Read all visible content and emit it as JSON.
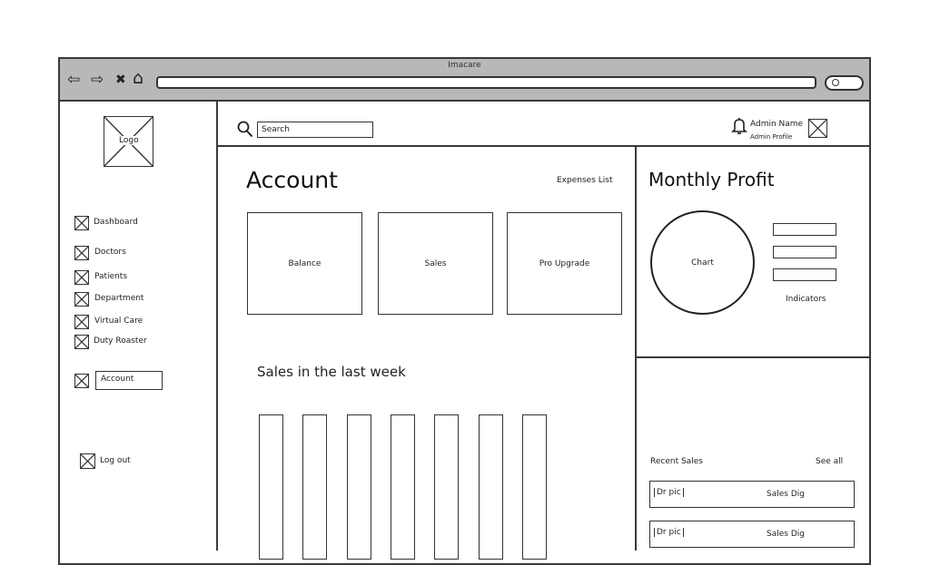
{
  "browser": {
    "title": "Imacare",
    "nav_back": "⇦",
    "nav_forward": "⇨",
    "nav_close": "✖",
    "nav_home": "⌂",
    "search_button": "🔍"
  },
  "sidebar": {
    "logo_label": "Logo",
    "items": [
      {
        "label": "Dashboard"
      },
      {
        "label": "Doctors"
      },
      {
        "label": "Patients"
      },
      {
        "label": "Department"
      },
      {
        "label": "Virtual Care"
      },
      {
        "label": "Duty Roaster"
      },
      {
        "label": "Account"
      }
    ],
    "logout_label": "Log out"
  },
  "header": {
    "search_placeholder": "Search",
    "admin_name": "Admin Name",
    "admin_profile": "Admin Profile"
  },
  "account": {
    "title": "Account",
    "expenses_link": "Expenses List",
    "cards": [
      {
        "label": "Balance"
      },
      {
        "label": "Sales"
      },
      {
        "label": "Pro Upgrade"
      }
    ],
    "sales_title": "Sales in the last week"
  },
  "profit": {
    "title": "Monthly Profit",
    "chart_label": "Chart",
    "indicators_label": "Indicators"
  },
  "recent_sales": {
    "title": "Recent Sales",
    "see_all": "See all",
    "rows": [
      {
        "pic": "Dr pic",
        "label": "Sales Dig"
      },
      {
        "pic": "Dr pic",
        "label": "Sales Dig"
      }
    ]
  }
}
